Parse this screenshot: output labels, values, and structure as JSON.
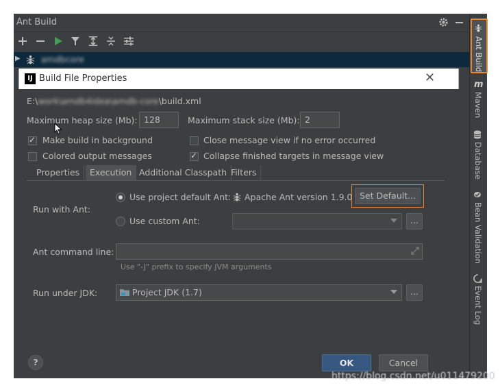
{
  "toolwindow": {
    "title": "Ant Build",
    "tree_item": "amdbcore"
  },
  "sidebar": {
    "items": [
      "Ant Build",
      "Maven",
      "Database",
      "Bean Validation",
      "Event Log"
    ]
  },
  "dialog": {
    "title": "Build File Properties",
    "path_prefix": "E:\\",
    "path_blurred": "work\\amdb4idea\\amdb-core",
    "path_suffix": "\\build.xml",
    "heap_label": "Maximum heap size (Mb):",
    "heap_value": "128",
    "stack_label": "Maximum stack size (Mb):",
    "stack_value": "2",
    "cb_background": "Make build in background",
    "cb_close": "Close message view if no error occurred",
    "cb_colored": "Colored output messages",
    "cb_collapse": "Collapse finished targets in message view",
    "tabs": [
      "Properties",
      "Execution",
      "Additional Classpath",
      "Filters"
    ],
    "run_with_ant_label": "Run with Ant:",
    "radio_default": "Use project default Ant:",
    "ant_version": "Apache Ant version 1.9.0",
    "set_default": "Set Default...",
    "radio_custom": "Use custom Ant:",
    "ellipsis": "...",
    "cmd_label": "Ant command line:",
    "cmd_hint": "Use \"-J\" prefix to specify JVM arguments",
    "jdk_label": "Run under JDK:",
    "jdk_value": "Project JDK (1.7)",
    "help": "?",
    "ok": "OK",
    "cancel": "Cancel"
  },
  "watermark": "https://blog.csdn.net/u011479200",
  "colors": {
    "accent_orange": "#e8852c",
    "ok_blue": "#365880",
    "bg": "#3c3f41"
  }
}
